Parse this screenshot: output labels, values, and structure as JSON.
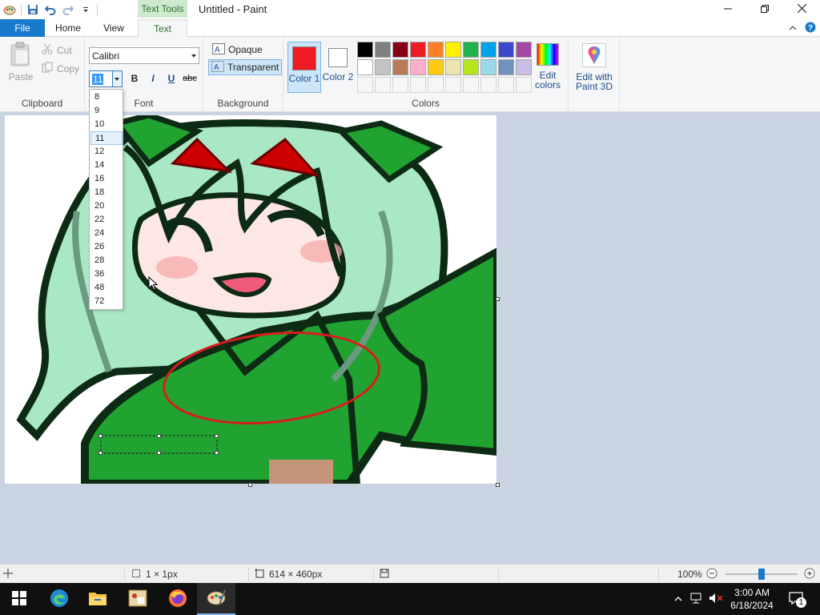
{
  "titlebar": {
    "contextual_tab": "Text Tools",
    "title": "Untitled - Paint"
  },
  "tabs": {
    "file": "File",
    "home": "Home",
    "view": "View",
    "text": "Text"
  },
  "clipboard": {
    "paste": "Paste",
    "cut": "Cut",
    "copy": "Copy",
    "label": "Clipboard"
  },
  "font": {
    "family": "Calibri",
    "size": "11",
    "bold": "B",
    "italic": "I",
    "underline": "U",
    "strike": "abc",
    "label": "Font",
    "size_options": [
      "8",
      "9",
      "10",
      "11",
      "12",
      "14",
      "16",
      "18",
      "20",
      "22",
      "24",
      "26",
      "28",
      "36",
      "48",
      "72"
    ],
    "selected_size": "11"
  },
  "background": {
    "opaque": "Opaque",
    "transparent": "Transparent",
    "selected": "Transparent",
    "label": "Background"
  },
  "colors": {
    "color1_label": "Color 1",
    "color2_label": "Color 2",
    "color1": "#ed1c24",
    "color2": "#ffffff",
    "edit_colors": "Edit colors",
    "label": "Colors",
    "palette_row1": [
      "#000000",
      "#7f7f7f",
      "#880015",
      "#ed1c24",
      "#ff7f27",
      "#fff200",
      "#22b14c",
      "#00a2e8",
      "#3f48cc",
      "#a349a4"
    ],
    "palette_row2": [
      "#ffffff",
      "#c3c3c3",
      "#b97a57",
      "#ffaec9",
      "#ffc90e",
      "#efe4b0",
      "#b5e61d",
      "#99d9ea",
      "#7092be",
      "#c8bfe7"
    ],
    "palette_row3": [
      "",
      "",
      "",
      "",
      "",
      "",
      "",
      "",
      "",
      ""
    ]
  },
  "paint3d": {
    "label": "Edit with Paint 3D"
  },
  "status": {
    "selection_size": "1 × 1px",
    "canvas_size": "614 × 460px",
    "zoom": "100%",
    "zoom_level": 0.5
  },
  "taskbar": {
    "time": "3:00 AM",
    "date": "6/18/2024",
    "notification_count": "1"
  }
}
